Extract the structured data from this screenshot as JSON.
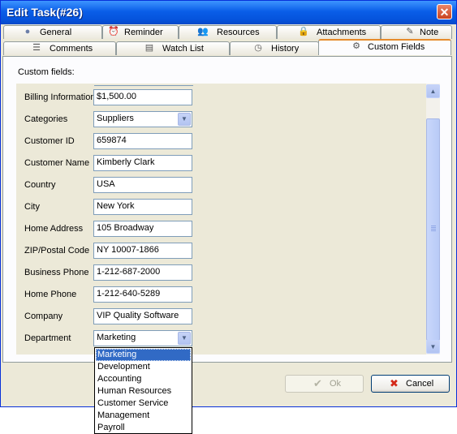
{
  "window": {
    "title": "Edit Task(#26)",
    "close_glyph": "✕"
  },
  "tabs_row1": [
    {
      "label": "General",
      "icon": "globe-icon",
      "glyph": "●"
    },
    {
      "label": "Reminder",
      "icon": "alarm-clock-icon",
      "glyph": "⏰"
    },
    {
      "label": "Resources",
      "icon": "people-icon",
      "glyph": "👥"
    },
    {
      "label": "Attachments",
      "icon": "lock-icon",
      "glyph": "🔒"
    },
    {
      "label": "Note",
      "icon": "note-pencil-icon",
      "glyph": "✎"
    }
  ],
  "tabs_row2": [
    {
      "label": "Comments",
      "icon": "comments-icon",
      "glyph": "☰"
    },
    {
      "label": "Watch List",
      "icon": "watchlist-icon",
      "glyph": "▤"
    },
    {
      "label": "History",
      "icon": "history-clock-icon",
      "glyph": "◷"
    },
    {
      "label": "Custom Fields",
      "icon": "gear-icon",
      "glyph": "⚙",
      "active": true
    }
  ],
  "custom_fields": {
    "heading": "Custom fields:",
    "fields": [
      {
        "label": "Billing Information",
        "value": "$1,500.00",
        "type": "text"
      },
      {
        "label": "Categories",
        "value": "Suppliers",
        "type": "dropdown"
      },
      {
        "label": "Customer ID",
        "value": "659874",
        "type": "text"
      },
      {
        "label": "Customer Name",
        "value": "Kimberly Clark",
        "type": "text"
      },
      {
        "label": "Country",
        "value": "USA",
        "type": "text"
      },
      {
        "label": "City",
        "value": "New York",
        "type": "text"
      },
      {
        "label": "Home Address",
        "value": "105 Broadway",
        "type": "text"
      },
      {
        "label": "ZIP/Postal Code",
        "value": "NY 10007-1866",
        "type": "text"
      },
      {
        "label": "Business Phone",
        "value": "1-212-687-2000",
        "type": "text"
      },
      {
        "label": "Home Phone",
        "value": "1-212-640-5289",
        "type": "text"
      },
      {
        "label": "Company",
        "value": "VIP Quality Software",
        "type": "text"
      },
      {
        "label": "Department",
        "value": "Marketing",
        "type": "dropdown"
      }
    ]
  },
  "department_dropdown": {
    "options": [
      "Marketing",
      "Development",
      "Accounting",
      "Human Resources",
      "Customer Service",
      "Management",
      "Payroll"
    ],
    "selected": "Marketing"
  },
  "scrollbar": {
    "up_glyph": "▲",
    "down_glyph": "▼"
  },
  "buttons": {
    "ok": {
      "label": "Ok",
      "glyph": "✔",
      "enabled": false
    },
    "cancel": {
      "label": "Cancel",
      "glyph": "✖",
      "enabled": true
    }
  },
  "colors": {
    "titlebar": "#0553dc",
    "active_tab_accent": "#e68b2c",
    "selection": "#316ac5",
    "cancel_icon": "#d42a1a"
  }
}
